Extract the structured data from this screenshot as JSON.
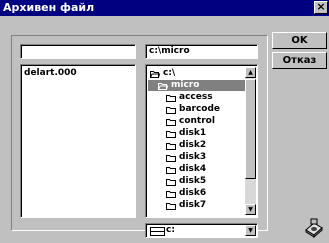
{
  "window": {
    "title": "Архивен файл",
    "close_label": "×"
  },
  "file_name_value": "",
  "path_value": "c:\\micro",
  "files": [
    "delart.000"
  ],
  "directories": [
    {
      "name": "c:\\",
      "level": 0,
      "selected": false
    },
    {
      "name": "micro",
      "level": 1,
      "selected": true
    },
    {
      "name": "access",
      "level": 2,
      "selected": false
    },
    {
      "name": "barcode",
      "level": 2,
      "selected": false
    },
    {
      "name": "control",
      "level": 2,
      "selected": false
    },
    {
      "name": "disk1",
      "level": 2,
      "selected": false
    },
    {
      "name": "disk2",
      "level": 2,
      "selected": false
    },
    {
      "name": "disk3",
      "level": 2,
      "selected": false
    },
    {
      "name": "disk4",
      "level": 2,
      "selected": false
    },
    {
      "name": "disk5",
      "level": 2,
      "selected": false
    },
    {
      "name": "disk6",
      "level": 2,
      "selected": false
    },
    {
      "name": "disk7",
      "level": 2,
      "selected": false
    }
  ],
  "drive": {
    "selected": "c:"
  },
  "buttons": {
    "ok": "OK",
    "cancel": "Отказ"
  }
}
